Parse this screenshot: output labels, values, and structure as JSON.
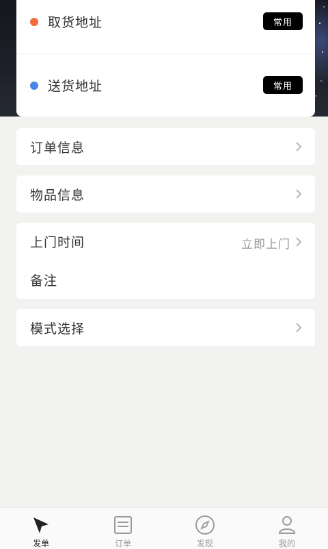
{
  "address": {
    "pickup": {
      "label": "取货地址",
      "tag": "常用",
      "dot_color": "#f26b3a"
    },
    "delivery": {
      "label": "送货地址",
      "tag": "常用",
      "dot_color": "#4a86e8"
    }
  },
  "sections": {
    "order_info": {
      "label": "订单信息"
    },
    "item_info": {
      "label": "物品信息"
    },
    "visit_time": {
      "label": "上门时间",
      "value": "立即上门"
    },
    "remark": {
      "label": "备注"
    },
    "mode": {
      "label": "模式选择"
    }
  },
  "tabbar": {
    "items": [
      {
        "label": "发单",
        "icon": "send-icon",
        "active": true
      },
      {
        "label": "订单",
        "icon": "list-icon",
        "active": false
      },
      {
        "label": "发现",
        "icon": "compass-icon",
        "active": false
      },
      {
        "label": "我的",
        "icon": "user-icon",
        "active": false
      }
    ]
  },
  "colors": {
    "accent_chip": "#000000",
    "pickup_dot": "#f26b3a",
    "delivery_dot": "#4a86e8"
  }
}
